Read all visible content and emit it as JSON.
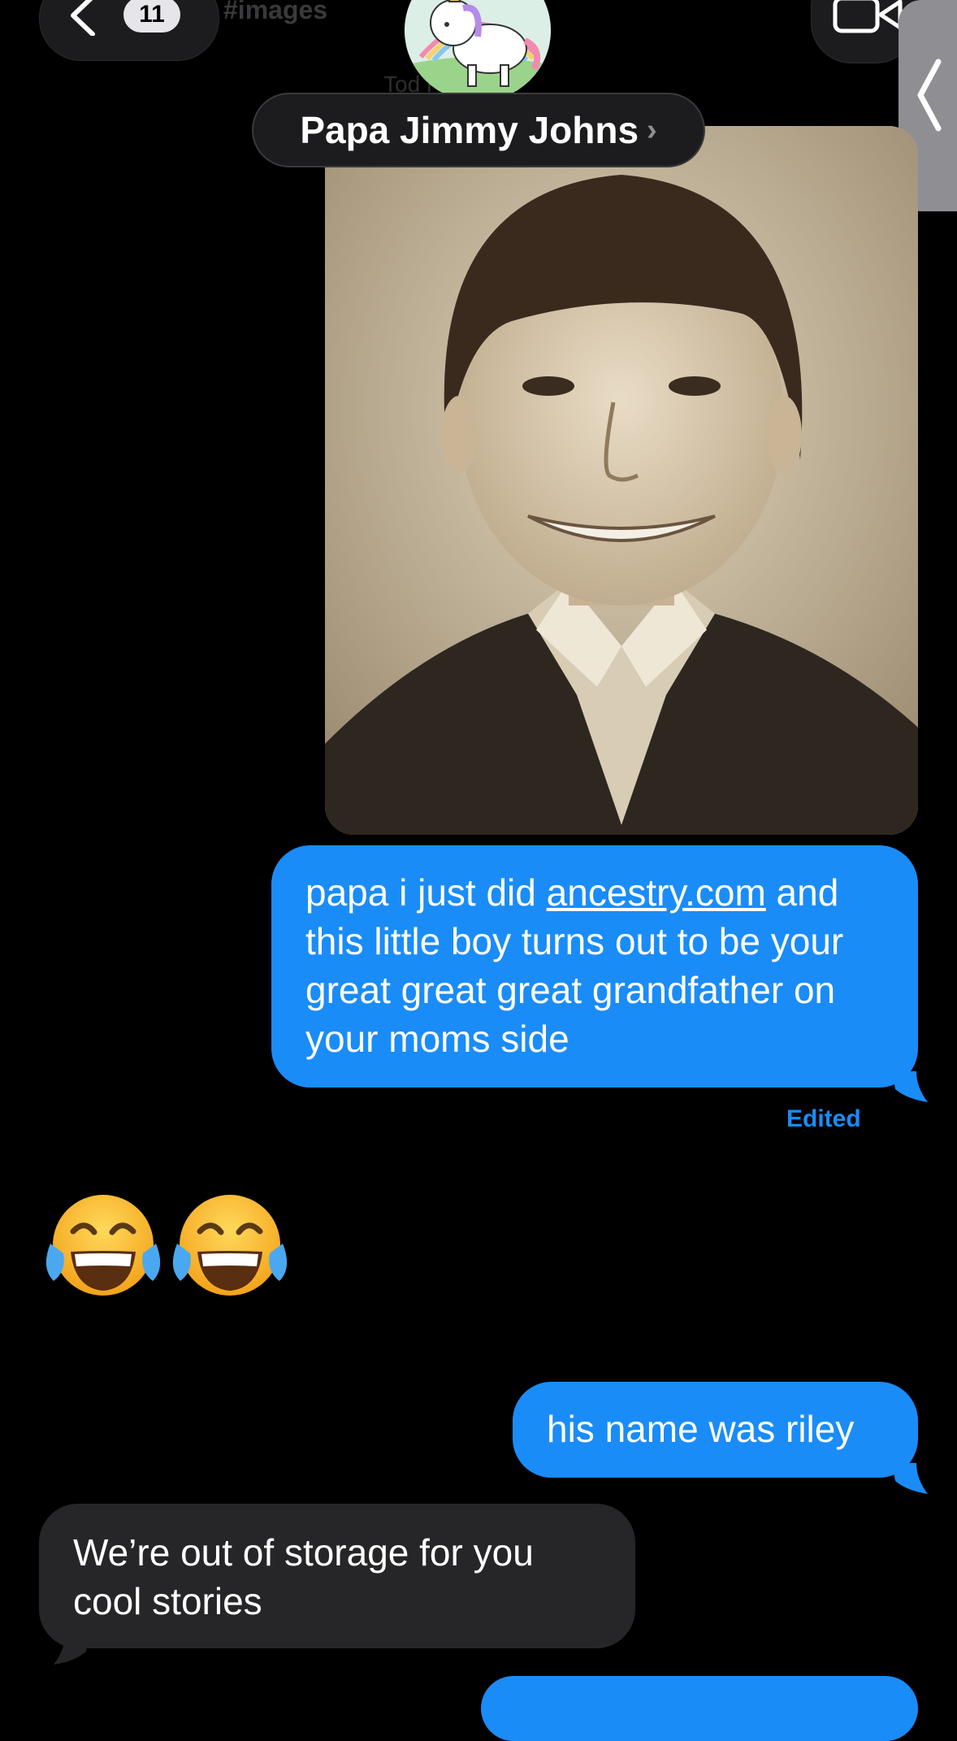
{
  "header": {
    "back_badge_count": "11",
    "ghost_tag": "#images",
    "ghost_timestamp": "Tod          PM",
    "contact_name": "Papa Jimmy Johns",
    "contact_chevron": "›"
  },
  "messages": [
    {
      "type": "image",
      "direction": "outgoing",
      "description_icon": "photo-attachment"
    },
    {
      "type": "text",
      "direction": "outgoing",
      "text_before_link": "papa i just did ",
      "link_text": "ancestry.com",
      "text_after_link": " and this little boy turns out to be your great great great grandfather on your moms side",
      "status": "Edited"
    },
    {
      "type": "emoji",
      "direction": "incoming",
      "emojis": [
        "face-with-tears-of-joy",
        "face-with-tears-of-joy"
      ]
    },
    {
      "type": "text",
      "direction": "outgoing",
      "text": "his name was riley"
    },
    {
      "type": "text",
      "direction": "incoming",
      "text": "We’re out of storage for you cool stories"
    }
  ],
  "colors": {
    "outgoing_bubble": "#1a8cf8",
    "incoming_bubble": "#262628",
    "background": "#000000",
    "edited_label": "#1a8cf8"
  }
}
